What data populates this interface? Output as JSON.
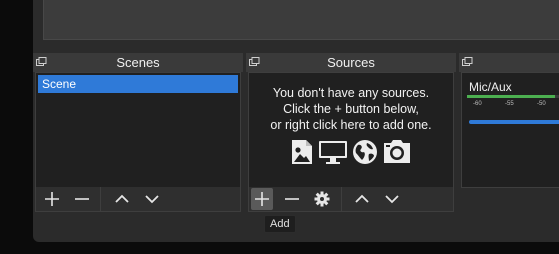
{
  "scenes_dock": {
    "title": "Scenes",
    "items": [
      {
        "label": "Scene",
        "selected": true
      }
    ],
    "toolbar": [
      "add-icon",
      "remove-icon",
      "move-up-icon",
      "move-down-icon"
    ]
  },
  "sources_dock": {
    "title": "Sources",
    "empty_line1": "You don't have any sources.",
    "empty_line2": "Click the + button below,",
    "empty_line3": "or right click here to add one.",
    "empty_icons": [
      "image-icon",
      "display-capture-icon",
      "globe-icon",
      "camera-icon"
    ],
    "toolbar": [
      "add-icon",
      "remove-icon",
      "gear-icon",
      "move-up-icon",
      "move-down-icon"
    ]
  },
  "mixer_dock": {
    "channel_label": "Mic/Aux",
    "meter_ticks": [
      "-60",
      "-55",
      "-50"
    ]
  },
  "tooltip": {
    "text": "Add"
  },
  "colors": {
    "accent": "#2f7ad8",
    "meter": "#4caf50",
    "panel": "#2b2b2b",
    "list_bg": "#202020"
  }
}
